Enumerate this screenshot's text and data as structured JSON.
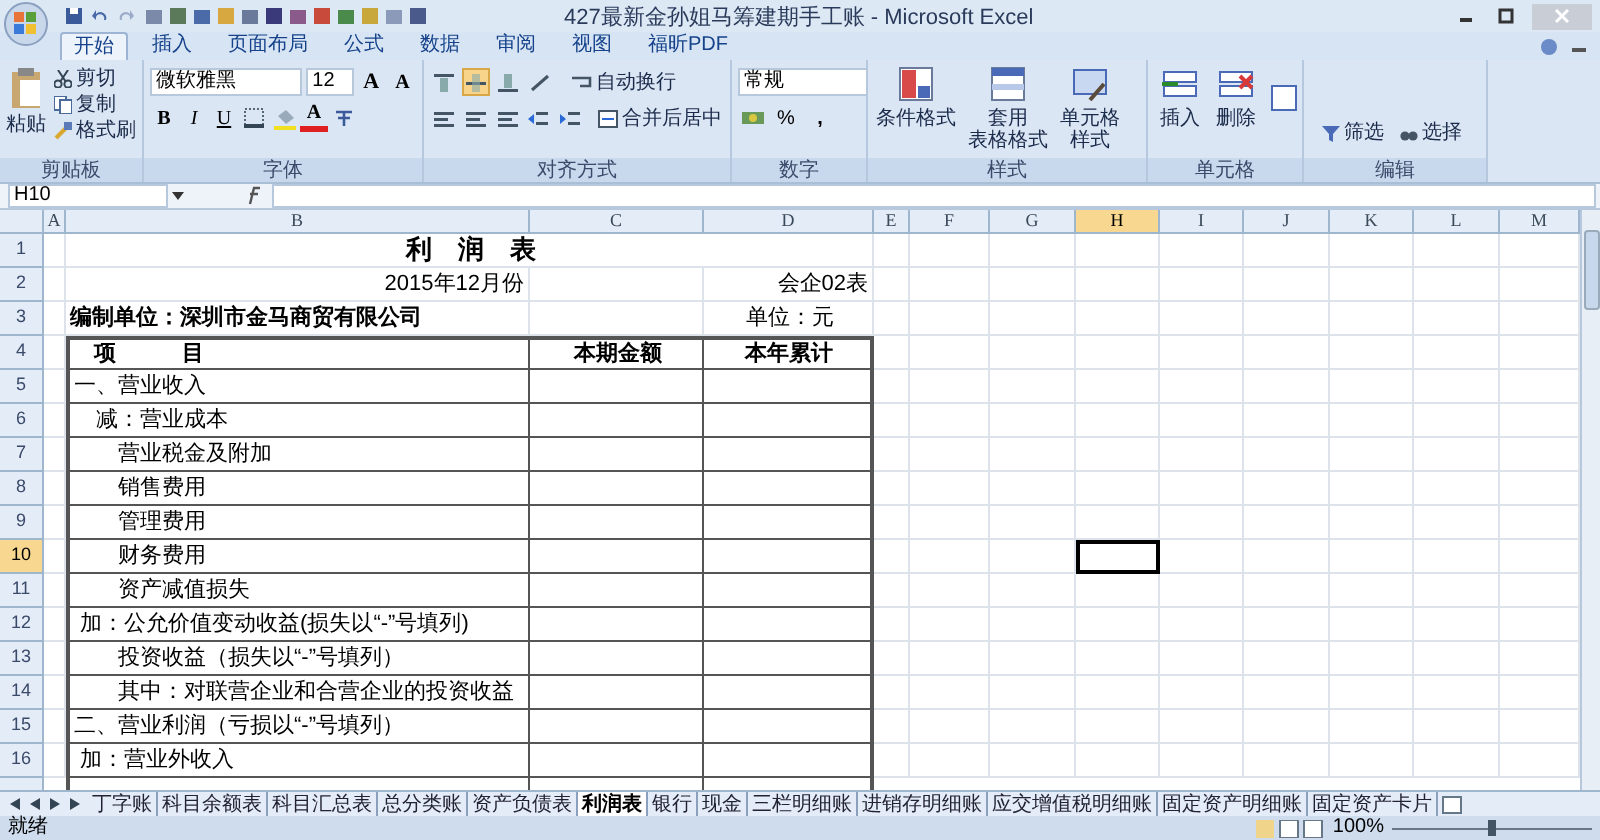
{
  "window": {
    "title": "427最新金孙姐马筹建期手工账 - Microsoft Excel"
  },
  "ribbon_tabs": [
    {
      "label": "开始",
      "selected": true
    },
    {
      "label": "插入",
      "selected": false
    },
    {
      "label": "页面布局",
      "selected": false
    },
    {
      "label": "公式",
      "selected": false
    },
    {
      "label": "数据",
      "selected": false
    },
    {
      "label": "审阅",
      "selected": false
    },
    {
      "label": "视图",
      "selected": false
    },
    {
      "label": "福昕PDF",
      "selected": false
    }
  ],
  "ribbon_groups": [
    {
      "kind": "clipboard",
      "label": "剪贴板",
      "buttons": [
        "粘贴",
        "剪切",
        "复制",
        "格式刷"
      ]
    },
    {
      "kind": "font",
      "label": "字体",
      "font_name": "微软雅黑",
      "font_size": "12",
      "buttons": [
        "A",
        "A",
        "B",
        "I",
        "U",
        "A"
      ]
    },
    {
      "kind": "alignment",
      "label": "对齐方式",
      "buttons": [
        "自动换行",
        "合并后居中"
      ]
    },
    {
      "kind": "number",
      "label": "数字",
      "format": "常规",
      "buttons": [
        "%",
        ","
      ]
    },
    {
      "kind": "styles",
      "label": "样式",
      "buttons": [
        {
          "lines": [
            "条件格式"
          ]
        },
        {
          "lines": [
            "套用",
            "表格格式"
          ]
        },
        {
          "lines": [
            "单元格",
            "样式"
          ]
        }
      ]
    },
    {
      "kind": "cells",
      "label": "单元格",
      "buttons": [
        "插入",
        "删除"
      ]
    },
    {
      "kind": "editing",
      "label": "编辑",
      "buttons": [
        "筛选",
        "选择"
      ]
    }
  ],
  "name_box": "H10",
  "columns": [
    {
      "label": "A",
      "selected": false
    },
    {
      "label": "B",
      "selected": false
    },
    {
      "label": "C",
      "selected": false
    },
    {
      "label": "D",
      "selected": false
    },
    {
      "label": "E",
      "selected": false
    },
    {
      "label": "F",
      "selected": false
    },
    {
      "label": "G",
      "selected": false
    },
    {
      "label": "H",
      "selected": true
    },
    {
      "label": "I",
      "selected": false
    },
    {
      "label": "J",
      "selected": false
    },
    {
      "label": "K",
      "selected": false
    },
    {
      "label": "L",
      "selected": false
    },
    {
      "label": "M",
      "selected": false
    }
  ],
  "rows": [
    {
      "number": "1",
      "kind": "title",
      "selected": false,
      "b": "利　润　表"
    },
    {
      "number": "2",
      "kind": "subtitle",
      "selected": false,
      "b": "2015年12月份",
      "d": "会企02表"
    },
    {
      "number": "3",
      "kind": "info",
      "selected": false,
      "b": "编制单位：深圳市金马商贸有限公司",
      "d": "单位：元"
    },
    {
      "number": "4",
      "kind": "table-header",
      "selected": false,
      "b": "项　　　目",
      "c": "本期金额",
      "d": "本年累计"
    },
    {
      "number": "5",
      "kind": "table-row",
      "selected": false,
      "b": "一、营业收入"
    },
    {
      "number": "6",
      "kind": "table-row",
      "selected": false,
      "b": "　减：营业成本"
    },
    {
      "number": "7",
      "kind": "table-row",
      "selected": false,
      "b": "　　营业税金及附加"
    },
    {
      "number": "8",
      "kind": "table-row",
      "selected": false,
      "b": "　　销售费用"
    },
    {
      "number": "9",
      "kind": "table-row",
      "selected": false,
      "b": "　　管理费用"
    },
    {
      "number": "10",
      "kind": "table-row",
      "selected": true,
      "b": "　　财务费用"
    },
    {
      "number": "11",
      "kind": "table-row",
      "selected": false,
      "b": "　　资产减值损失"
    },
    {
      "number": "12",
      "kind": "table-row",
      "selected": false,
      "b": " 加：公允价值变动收益(损失以“-”号填列)"
    },
    {
      "number": "13",
      "kind": "table-row",
      "selected": false,
      "b": "　　投资收益（损失以“-”号填列）"
    },
    {
      "number": "14",
      "kind": "table-row",
      "selected": false,
      "b": "　　其中：对联营企业和合营企业的投资收益"
    },
    {
      "number": "15",
      "kind": "table-row",
      "selected": false,
      "b": "二、营业利润（亏损以“-”号填列）"
    },
    {
      "number": "16",
      "kind": "table-row",
      "selected": false,
      "b": " 加：营业外收入"
    }
  ],
  "sheet_tabs": [
    {
      "label": "丁字账",
      "selected": false
    },
    {
      "label": "科目余额表",
      "selected": false
    },
    {
      "label": "科目汇总表",
      "selected": false
    },
    {
      "label": "总分类账",
      "selected": false
    },
    {
      "label": "资产负债表",
      "selected": false
    },
    {
      "label": "利润表",
      "selected": true
    },
    {
      "label": "银行",
      "selected": false
    },
    {
      "label": "现金",
      "selected": false
    },
    {
      "label": "三栏明细账",
      "selected": false
    },
    {
      "label": "进销存明细账",
      "selected": false
    },
    {
      "label": "应交增值税明细账",
      "selected": false
    },
    {
      "label": "固定资产明细账",
      "selected": false
    },
    {
      "label": "固定资产卡片",
      "selected": false
    }
  ],
  "status_bar": {
    "text": "就绪",
    "zoom": "100%",
    "zoom_slider": {
      "level": 0.5
    }
  }
}
